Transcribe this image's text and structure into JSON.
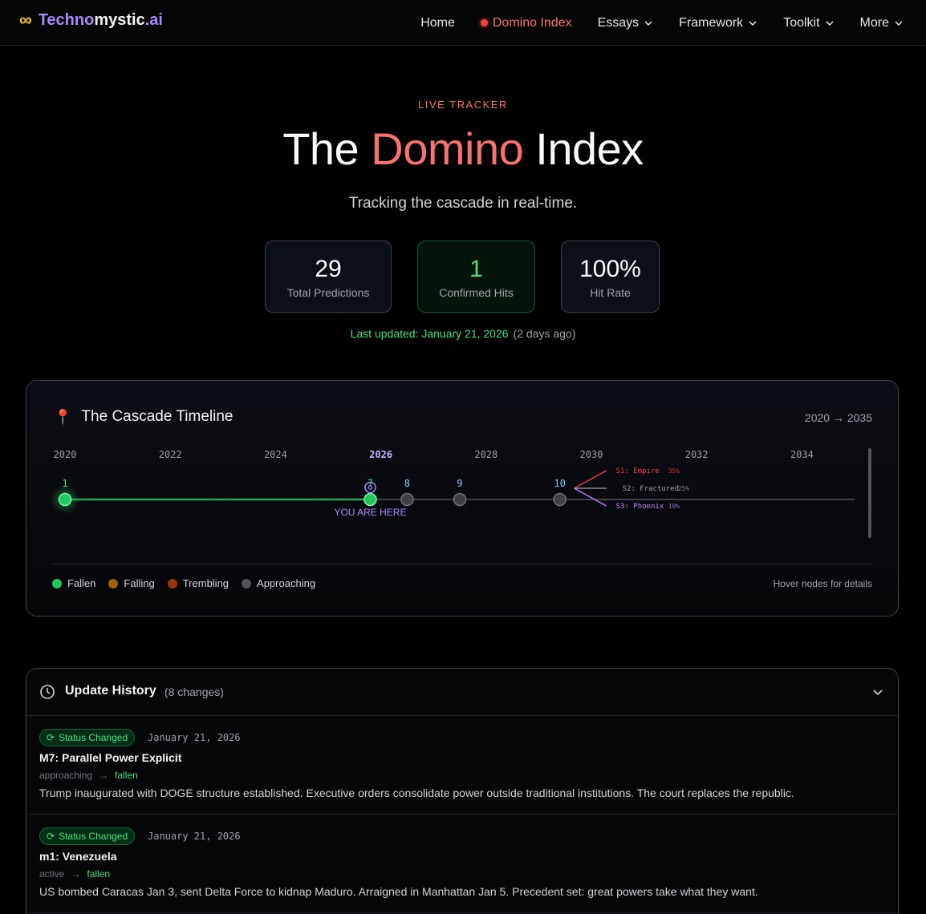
{
  "nav": {
    "logo_prefix": "Techno",
    "logo_mid": "mystic",
    "logo_suffix": ".ai",
    "items": [
      {
        "label": "Home"
      },
      {
        "label": "Domino Index"
      },
      {
        "label": "Essays"
      },
      {
        "label": "Framework"
      },
      {
        "label": "Toolkit"
      },
      {
        "label": "More"
      }
    ]
  },
  "hero": {
    "eyebrow": "LIVE TRACKER",
    "title_a": "The ",
    "title_b": "Domino",
    "title_c": " Index",
    "subtitle": "Tracking the cascade in real-time."
  },
  "stats": [
    {
      "value": "29",
      "label": "Total Predictions"
    },
    {
      "value": "1",
      "label": "Confirmed Hits"
    },
    {
      "value": "100%",
      "label": "Hit Rate"
    }
  ],
  "updated": {
    "text": "Last updated: January 21, 2026",
    "relative": "(2 days ago)"
  },
  "timeline": {
    "title": "The Cascade Timeline",
    "range": "2020 → 2035",
    "years": [
      "2020",
      "2022",
      "2024",
      "2026",
      "2028",
      "2030",
      "2032",
      "2034"
    ],
    "current_year": "2026",
    "nodes": [
      {
        "label": "1",
        "year": 2020.0,
        "status": "fallen"
      },
      {
        "label": "7",
        "year": 2025.8,
        "status": "fallen",
        "current": true
      },
      {
        "label": "8",
        "year": 2026.5,
        "status": "approaching"
      },
      {
        "label": "9",
        "year": 2027.5,
        "status": "approaching"
      },
      {
        "label": "10",
        "year": 2029.4,
        "status": "approaching"
      }
    ],
    "you_are_here": "YOU ARE HERE",
    "scenarios": [
      {
        "name": "S1: Empire",
        "pct": "35%",
        "color": "#ef4444"
      },
      {
        "name": "S2: Fractured",
        "pct": "25%",
        "color": "#a1a1aa"
      },
      {
        "name": "S3: Phoenix",
        "pct": "10%",
        "color": "#c084fc"
      }
    ],
    "legend": [
      {
        "label": "Fallen",
        "color": "#22c55e"
      },
      {
        "label": "Falling",
        "color": "#a16207"
      },
      {
        "label": "Trembling",
        "color": "#9a3412"
      },
      {
        "label": "Approaching",
        "color": "#52525b"
      }
    ],
    "hint": "Hover nodes for details"
  },
  "history": {
    "title": "Update History",
    "count": "(8 changes)",
    "entries": [
      {
        "badge": "Status Changed",
        "date": "January 21, 2026",
        "title": "M7: Parallel Power Explicit",
        "from": "approaching",
        "to": "fallen",
        "desc": "Trump inaugurated with DOGE structure established. Executive orders consolidate power outside traditional institutions. The court replaces the republic."
      },
      {
        "badge": "Status Changed",
        "date": "January 21, 2026",
        "title": "m1: Venezuela",
        "from": "active",
        "to": "fallen",
        "desc": "US bombed Caracas Jan 3, sent Delta Force to kidnap Maduro. Arraigned in Manhattan Jan 5. Precedent set: great powers take what they want."
      }
    ]
  }
}
